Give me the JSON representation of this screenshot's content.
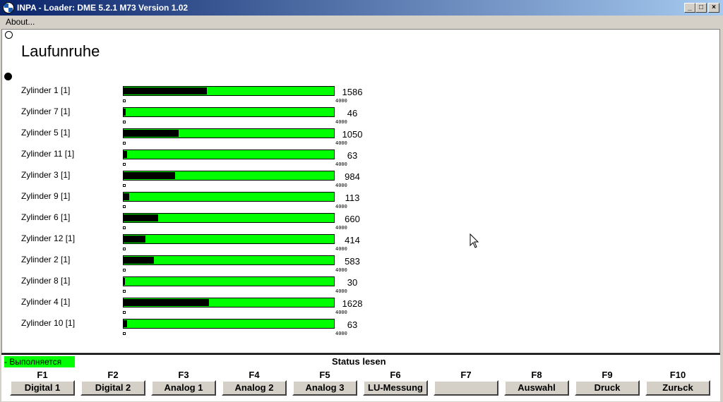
{
  "window": {
    "title": "INPA - Loader:  DME 5.2.1 M73 Version 1.02",
    "minimize_glyph": "_",
    "maximize_glyph": "□",
    "close_glyph": "×"
  },
  "menu": {
    "about": "About..."
  },
  "page": {
    "title": "Laufunruhe"
  },
  "gauge_scale": {
    "min_label": "0",
    "max_label": "4000",
    "max_value": 4000
  },
  "rows": [
    {
      "label": "Zylinder 1 [1]",
      "value": 1586
    },
    {
      "label": "Zylinder 7 [1]",
      "value": 46
    },
    {
      "label": "Zylinder 5 [1]",
      "value": 1050
    },
    {
      "label": "Zylinder 11 [1]",
      "value": 63
    },
    {
      "label": "Zylinder 3  [1]",
      "value": 984
    },
    {
      "label": "Zylinder 9 [1]",
      "value": 113
    },
    {
      "label": "Zylinder 6 [1]",
      "value": 660
    },
    {
      "label": "Zylinder 12 [1]",
      "value": 414
    },
    {
      "label": "Zylinder 2 [1]",
      "value": 583
    },
    {
      "label": "Zylinder 8 [1]",
      "value": 30
    },
    {
      "label": "Zylinder 4 [1]",
      "value": 1628
    },
    {
      "label": "Zylinder 10 [1]",
      "value": 63
    }
  ],
  "colors": {
    "bar_background": "#00ff00",
    "bar_fill": "#000000",
    "running_badge": "#00ff00"
  },
  "status": {
    "running": "- Выполняется",
    "title": "Status lesen"
  },
  "fkeys": [
    {
      "key": "F1",
      "label": "Digital 1"
    },
    {
      "key": "F2",
      "label": "Digital 2"
    },
    {
      "key": "F3",
      "label": "Analog 1"
    },
    {
      "key": "F4",
      "label": "Analog 2"
    },
    {
      "key": "F5",
      "label": "Analog 3"
    },
    {
      "key": "F6",
      "label": "LU-Messung"
    },
    {
      "key": "F7",
      "label": ""
    },
    {
      "key": "F8",
      "label": "Auswahl"
    },
    {
      "key": "F9",
      "label": "Druck"
    },
    {
      "key": "F10",
      "label": "Zurьck"
    }
  ],
  "icons": {
    "app": "bmw-logo-icon",
    "cursor": "mouse-pointer-icon"
  }
}
